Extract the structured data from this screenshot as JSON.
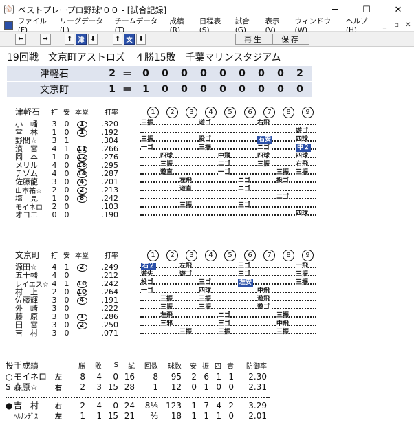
{
  "window": {
    "title": "ベストプレープロ野球'００ - [試合記録]",
    "minimize": "─",
    "maximize": "☐",
    "close": "✕"
  },
  "menu": [
    "ファイル(F)",
    "リーグデータ(L)",
    "チームデータ(T)",
    "成績(R)",
    "日程表(S)",
    "試合(G)",
    "表示(V)",
    "ウィンドウ(W)",
    "ヘルプ(H)"
  ],
  "mdi": [
    "_",
    "▫",
    "✕"
  ],
  "toolbar": {
    "prev": "⬅",
    "next": "➡",
    "up1": "⬆",
    "team1": "津",
    "down1": "⬇",
    "up2": "⬆",
    "team2": "文",
    "down2": "⬇",
    "replay": "再生",
    "save": "保存"
  },
  "header": "19回戦　文京町アストロズ　４勝15敗　千葉マリンスタジアム",
  "line_score": [
    {
      "team": "津軽石",
      "total": "2",
      "eq": "＝",
      "innings": [
        "0",
        "0",
        "0",
        "0",
        "0",
        "0",
        "0",
        "0",
        "2"
      ]
    },
    {
      "team": "文京町",
      "total": "1",
      "eq": "＝",
      "innings": [
        "1",
        "0",
        "0",
        "0",
        "0",
        "0",
        "0",
        "0",
        "0"
      ]
    }
  ],
  "cols": {
    "ab": "打",
    "h": "安",
    "hr": "本塁",
    "avg": "打率"
  },
  "inning_labels": [
    "1",
    "2",
    "3",
    "4",
    "5",
    "6",
    "7",
    "8",
    "9"
  ],
  "away": {
    "name": "津軽石",
    "rows": [
      {
        "name": "小　幡",
        "ab": "3",
        "h": "0",
        "hr": "1",
        "avg": ".320",
        "abs": [
          [
            "三振",
            0,
            false
          ],
          [
            "遊ゴ",
            3,
            false
          ],
          [
            "右飛",
            6,
            false
          ]
        ]
      },
      {
        "name": "堂　林",
        "ab": "1",
        "h": "0",
        "hr": "1",
        "avg": ".192",
        "abs": [
          [
            "遊ゴ",
            8,
            false
          ]
        ]
      },
      {
        "name": "野間☆",
        "ab": "3",
        "h": "1",
        "hr": "",
        "avg": ".304",
        "abs": [
          [
            "三振",
            0,
            false
          ],
          [
            "投ゴ",
            3,
            false
          ],
          [
            "右安",
            6,
            true
          ],
          [
            "四球",
            8,
            false
          ]
        ]
      },
      {
        "name": "濱　宮",
        "ab": "4",
        "h": "1",
        "hr": "11",
        "avg": ".266",
        "abs": [
          [
            "一ゴ",
            0,
            false
          ],
          [
            "三振",
            3,
            false
          ],
          [
            "ニゴ",
            6,
            false
          ],
          [
            "中２",
            8,
            true
          ]
        ]
      },
      {
        "name": "岡　本",
        "ab": "1",
        "h": "0",
        "hr": "12",
        "avg": ".276",
        "abs": [
          [
            "四球",
            1,
            false
          ],
          [
            "中飛",
            4,
            false
          ],
          [
            "四球",
            6,
            false
          ],
          [
            "四球",
            8,
            false
          ]
        ]
      },
      {
        "name": "メリル",
        "ab": "4",
        "h": "0",
        "hr": "18",
        "avg": ".295",
        "abs": [
          [
            "三振",
            1,
            false
          ],
          [
            "ニゴ",
            4,
            false
          ],
          [
            "三振",
            6,
            false
          ],
          [
            "右飛",
            8,
            false
          ]
        ]
      },
      {
        "name": "チゾム",
        "ab": "4",
        "h": "0",
        "hr": "14",
        "avg": ".287",
        "abs": [
          [
            "遊直",
            1,
            false
          ],
          [
            "一ゴ",
            4,
            false
          ],
          [
            "三振",
            7,
            false
          ],
          [
            "三振",
            8,
            false
          ]
        ]
      },
      {
        "name": "佐藤龍",
        "ab": "3",
        "h": "0",
        "hr": "4",
        "avg": ".201",
        "abs": [
          [
            "左飛",
            2,
            false
          ],
          [
            "ニゴ",
            5,
            false
          ],
          [
            "投ゴ",
            7,
            false
          ]
        ]
      },
      {
        "name": "山本祐☆",
        "ab": "2",
        "h": "0",
        "hr": "2",
        "avg": ".213",
        "abs": [
          [
            "遊直",
            2,
            false
          ],
          [
            "ニゴ",
            5,
            false
          ]
        ]
      },
      {
        "name": "塩　見",
        "ab": "1",
        "h": "0",
        "hr": "8",
        "avg": ".242",
        "abs": [
          [
            "ニゴ",
            7,
            false
          ]
        ]
      },
      {
        "name": "モイネロ",
        "ab": "2",
        "h": "0",
        "hr": "",
        "avg": ".103",
        "abs": [
          [
            "三振",
            2,
            false
          ],
          [
            "三ゴ",
            5,
            false
          ]
        ]
      },
      {
        "name": "オコエ",
        "ab": "0",
        "h": "0",
        "hr": "",
        "avg": ".190",
        "abs": [
          [
            "四球",
            8,
            false
          ]
        ]
      }
    ]
  },
  "home": {
    "name": "文京町",
    "rows": [
      {
        "name": "源田☆",
        "ab": "4",
        "h": "1",
        "hr": "2",
        "avg": ".249",
        "abs": [
          [
            "右２",
            0,
            true
          ],
          [
            "左飛",
            2,
            false
          ],
          [
            "三ゴ",
            5,
            false
          ],
          [
            "一飛",
            8,
            false
          ]
        ]
      },
      {
        "name": "五十幡",
        "ab": "4",
        "h": "0",
        "hr": "",
        "avg": ".212",
        "abs": [
          [
            "遊失",
            0,
            false
          ],
          [
            "遊ゴ",
            2,
            false
          ],
          [
            "三ゴ",
            5,
            false
          ],
          [
            "三振",
            8,
            false
          ]
        ]
      },
      {
        "name": "レイエス☆",
        "ab": "4",
        "h": "1",
        "hr": "16",
        "avg": ".242",
        "abs": [
          [
            "投ゴ",
            0,
            false
          ],
          [
            "三ゴ",
            3,
            false
          ],
          [
            "左安",
            5,
            true
          ],
          [
            "三振",
            8,
            false
          ]
        ]
      },
      {
        "name": "村　上",
        "ab": "2",
        "h": "0",
        "hr": "10",
        "avg": ".264",
        "abs": [
          [
            "一ゴ",
            0,
            false
          ],
          [
            "四球",
            3,
            false
          ],
          [
            "中飛",
            6,
            false
          ]
        ]
      },
      {
        "name": "佐藤輝",
        "ab": "3",
        "h": "0",
        "hr": "4",
        "avg": ".191",
        "abs": [
          [
            "三振",
            1,
            false
          ],
          [
            "三振",
            3,
            false
          ],
          [
            "遊飛",
            6,
            false
          ]
        ]
      },
      {
        "name": "外　崎",
        "ab": "3",
        "h": "0",
        "hr": "",
        "avg": ".222",
        "abs": [
          [
            "三振",
            1,
            false
          ],
          [
            "三振",
            3,
            false
          ],
          [
            "遊ゴ",
            6,
            false
          ]
        ]
      },
      {
        "name": "藤　原",
        "ab": "3",
        "h": "0",
        "hr": "1",
        "avg": ".286",
        "abs": [
          [
            "左飛",
            1,
            false
          ],
          [
            "ニゴ",
            4,
            false
          ],
          [
            "三振",
            7,
            false
          ]
        ]
      },
      {
        "name": "田　宮",
        "ab": "3",
        "h": "0",
        "hr": "2",
        "avg": ".250",
        "abs": [
          [
            "三邪",
            1,
            false
          ],
          [
            "三ゴ",
            4,
            false
          ],
          [
            "中飛",
            7,
            false
          ]
        ]
      },
      {
        "name": "吉　村",
        "ab": "3",
        "h": "0",
        "hr": "",
        "avg": ".071",
        "abs": [
          [
            "三振",
            2,
            false
          ],
          [
            "三振",
            4,
            false
          ],
          [
            "三振",
            7,
            false
          ]
        ]
      }
    ]
  },
  "pitching": {
    "title": "投手成績",
    "cols": [
      "勝",
      "敗",
      "S",
      "試",
      "回数",
      "球数",
      "安",
      "振",
      "四",
      "責",
      "防御率"
    ],
    "rows": [
      {
        "mark": "○",
        "name": "モイネロ",
        "hand": "左",
        "vals": [
          "8",
          "4",
          "0",
          "16",
          "8",
          "95",
          "2",
          "6",
          "1",
          "1",
          "2.30"
        ]
      },
      {
        "mark": "S",
        "name": "森原☆",
        "hand": "右",
        "vals": [
          "2",
          "3",
          "15",
          "28",
          "1",
          "12",
          "0",
          "1",
          "0",
          "0",
          "2.31"
        ]
      },
      {
        "mark": "●",
        "name": "吉　村",
        "hand": "右",
        "vals": [
          "2",
          "4",
          "0",
          "24",
          "8⅓",
          "123",
          "1",
          "7",
          "4",
          "2",
          "3.29"
        ]
      },
      {
        "mark": "",
        "name": "ﾍﾙﾅﾝﾃﾞｽ",
        "hand": "左",
        "vals": [
          "1",
          "1",
          "15",
          "21",
          "⅔",
          "18",
          "1",
          "1",
          "1",
          "0",
          "2.01"
        ]
      }
    ]
  }
}
